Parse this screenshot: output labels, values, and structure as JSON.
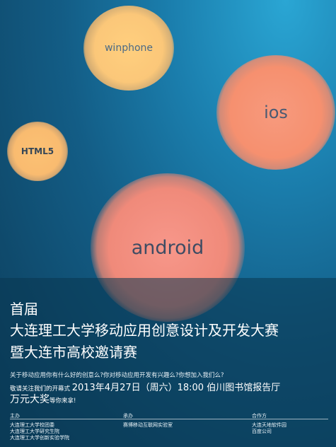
{
  "bubbles": {
    "winphone": "winphone",
    "ios": "ios",
    "html5": "HTML5",
    "android": "android"
  },
  "title": {
    "line1": "首届",
    "line2": "大连理工大学移动应用创意设计及开发大赛",
    "line3": "暨大连市高校邀请赛"
  },
  "intro": "关于移动应用你有什么好的创意么?你对移动应用开发有兴趣么?你想加入我们么?",
  "details": {
    "prefix": "敬请关注我们的开幕式",
    "datetime": "2013年4月27日（周六）18:00 伯川图书馆报告厅"
  },
  "prize": {
    "amount": "万元大奖",
    "suffix": "等你来拿!"
  },
  "organizers": {
    "host_label": "主办",
    "host_items": [
      "大连理工大学校团委",
      "大连理工大学研究生院",
      "大连理工大学创新实验学院"
    ],
    "undertake_label": "承办",
    "undertake_items": [
      "赛博移动互联网实验室"
    ],
    "cooperate_label": "合作方",
    "cooperate_items": [
      "大连天地软件园",
      "百度公司"
    ]
  }
}
